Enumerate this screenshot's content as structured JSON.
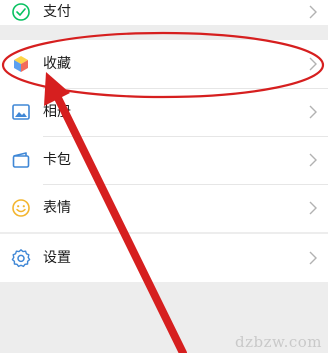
{
  "menu": {
    "items": [
      {
        "label": "支付",
        "icon": "wechat-pay-icon"
      },
      {
        "label": "收藏",
        "icon": "favorites-cube-icon"
      },
      {
        "label": "相册",
        "icon": "album-icon"
      },
      {
        "label": "卡包",
        "icon": "card-wallet-icon"
      },
      {
        "label": "表情",
        "icon": "sticker-smiley-icon"
      },
      {
        "label": "设置",
        "icon": "settings-gear-icon"
      }
    ]
  },
  "colors": {
    "accent": "#07c160",
    "annotation": "#d61f1f",
    "background": "#ededed"
  },
  "watermark": "dzbzw.com"
}
